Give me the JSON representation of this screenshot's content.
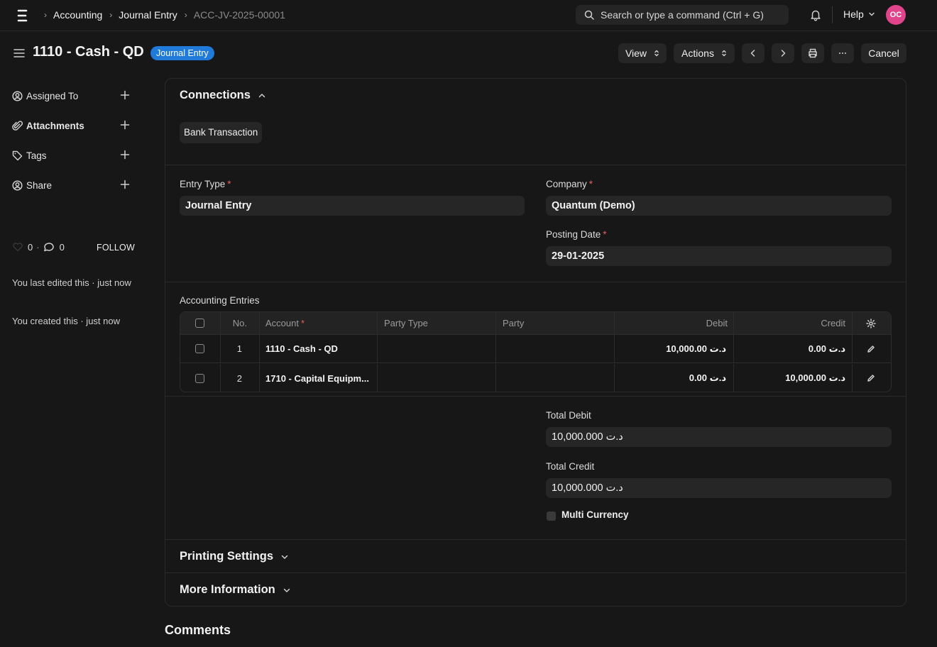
{
  "navbar": {
    "breadcrumbs": [
      "Accounting",
      "Journal Entry",
      "ACC-JV-2025-00001"
    ],
    "search_placeholder": "Search or type a command (Ctrl + G)",
    "help_label": "Help",
    "avatar_initials": "OC",
    "avatar_color": "#e0458b"
  },
  "page": {
    "title": "1110 - Cash - QD",
    "status_badge": "Journal Entry",
    "badge_color": "#1f7ad9"
  },
  "toolbar": {
    "view_label": "View",
    "actions_label": "Actions",
    "cancel_label": "Cancel"
  },
  "sidebar": {
    "items": [
      {
        "label": "Assigned To",
        "icon": "user-circle-icon"
      },
      {
        "label": "Attachments",
        "icon": "paperclip-icon"
      },
      {
        "label": "Tags",
        "icon": "tag-icon"
      },
      {
        "label": "Share",
        "icon": "share-user-icon"
      }
    ],
    "likes_count": "0",
    "comments_count": "0",
    "follow_label": "FOLLOW",
    "last_edited": "You last edited this · just now",
    "created": "You created this · just now"
  },
  "connections": {
    "title": "Connections",
    "links": [
      "Bank Transaction"
    ]
  },
  "form": {
    "entry_type_label": "Entry Type",
    "entry_type_value": "Journal Entry",
    "company_label": "Company",
    "company_value": "Quantum (Demo)",
    "posting_date_label": "Posting Date",
    "posting_date_value": "29-01-2025",
    "accounting_entries_label": "Accounting Entries",
    "total_debit_label": "Total Debit",
    "total_debit_value": "10,000.000 د.ت",
    "total_credit_label": "Total Credit",
    "total_credit_value": "10,000.000 د.ت",
    "multi_currency_label": "Multi Currency"
  },
  "table": {
    "columns": [
      "No.",
      "Account",
      "Party Type",
      "Party",
      "Debit",
      "Credit"
    ],
    "rows": [
      {
        "no": "1",
        "account": "1110 - Cash - QD",
        "party_type": "",
        "party": "",
        "debit": "10,000.00 د.ت",
        "credit": "0.00 د.ت"
      },
      {
        "no": "2",
        "account": "1710 - Capital Equipm...",
        "party_type": "",
        "party": "",
        "debit": "0.00 د.ت",
        "credit": "10,000.00 د.ت"
      }
    ]
  },
  "sections": {
    "printing_settings": "Printing Settings",
    "more_information": "More Information",
    "comments": "Comments"
  }
}
